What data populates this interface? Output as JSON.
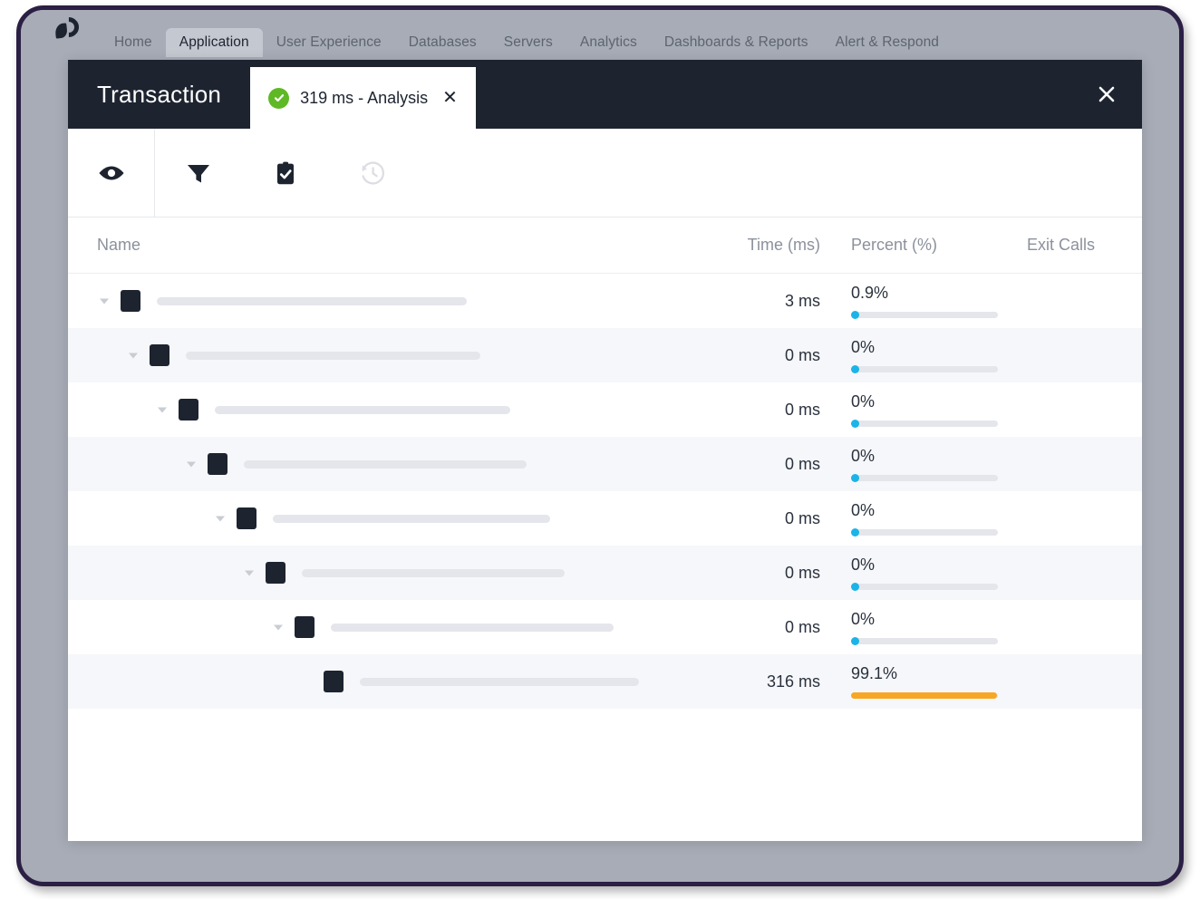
{
  "theme": {
    "frame_border": "#2b1f44",
    "frame_bg": "#a7acb6",
    "panel_bg": "#ffffff",
    "titlebar_bg": "#1d2430",
    "accent_blue": "#1bb4e8",
    "accent_orange": "#f7a723",
    "status_green": "#5eb924",
    "row_alt_bg": "#f6f7fa",
    "skeleton_gray": "#e4e6eb",
    "muted_text": "#8b919c"
  },
  "product_nav": {
    "logo_name": "appdynamics-logo",
    "items": [
      {
        "label": "Home",
        "active": false
      },
      {
        "label": "Application",
        "active": true
      },
      {
        "label": "User Experience",
        "active": false
      },
      {
        "label": "Databases",
        "active": false
      },
      {
        "label": "Servers",
        "active": false
      },
      {
        "label": "Analytics",
        "active": false
      },
      {
        "label": "Dashboards & Reports",
        "active": false
      },
      {
        "label": "Alert & Respond",
        "active": false
      }
    ]
  },
  "modal": {
    "title": "Transaction",
    "close_label": "✕",
    "tab": {
      "label": "319 ms - Analysis",
      "status": "success",
      "close_label": "✕"
    }
  },
  "toolbar": {
    "buttons": [
      {
        "name": "view-eye-icon",
        "tooltip": "View",
        "enabled": true,
        "divider": true
      },
      {
        "name": "filter-funnel-icon",
        "tooltip": "Filter",
        "enabled": true,
        "divider": false
      },
      {
        "name": "clipboard-check-icon",
        "tooltip": "Snapshots",
        "enabled": true,
        "divider": false
      },
      {
        "name": "history-clock-icon",
        "tooltip": "History",
        "enabled": false,
        "divider": false
      }
    ]
  },
  "table": {
    "columns": [
      {
        "key": "name",
        "label": "Name"
      },
      {
        "key": "time",
        "label": "Time (ms)"
      },
      {
        "key": "pct",
        "label": "Percent (%)"
      },
      {
        "key": "exit",
        "label": "Exit Calls"
      }
    ],
    "rows": [
      {
        "depth": 0,
        "expandable": true,
        "name_redacted": true,
        "skeleton_width": 342,
        "time": "3 ms",
        "percent_label": "0.9%",
        "percent_value": 0.9,
        "bar_color": "#1bb4e8",
        "exit_calls": ""
      },
      {
        "depth": 1,
        "expandable": true,
        "name_redacted": true,
        "skeleton_width": 325,
        "time": "0 ms",
        "percent_label": "0%",
        "percent_value": 0,
        "bar_color": "#1bb4e8",
        "exit_calls": ""
      },
      {
        "depth": 2,
        "expandable": true,
        "name_redacted": true,
        "skeleton_width": 326,
        "time": "0 ms",
        "percent_label": "0%",
        "percent_value": 0,
        "bar_color": "#1bb4e8",
        "exit_calls": ""
      },
      {
        "depth": 3,
        "expandable": true,
        "name_redacted": true,
        "skeleton_width": 312,
        "time": "0 ms",
        "percent_label": "0%",
        "percent_value": 0,
        "bar_color": "#1bb4e8",
        "exit_calls": ""
      },
      {
        "depth": 4,
        "expandable": true,
        "name_redacted": true,
        "skeleton_width": 306,
        "time": "0 ms",
        "percent_label": "0%",
        "percent_value": 0,
        "bar_color": "#1bb4e8",
        "exit_calls": ""
      },
      {
        "depth": 5,
        "expandable": true,
        "name_redacted": true,
        "skeleton_width": 290,
        "time": "0 ms",
        "percent_label": "0%",
        "percent_value": 0,
        "bar_color": "#1bb4e8",
        "exit_calls": ""
      },
      {
        "depth": 6,
        "expandable": true,
        "name_redacted": true,
        "skeleton_width": 312,
        "time": "0 ms",
        "percent_label": "0%",
        "percent_value": 0,
        "bar_color": "#1bb4e8",
        "exit_calls": ""
      },
      {
        "depth": 7,
        "expandable": false,
        "name_redacted": true,
        "skeleton_width": 326,
        "time": "316 ms",
        "percent_label": "99.1%",
        "percent_value": 99.1,
        "bar_color": "#f7a723",
        "exit_calls": ""
      }
    ]
  }
}
